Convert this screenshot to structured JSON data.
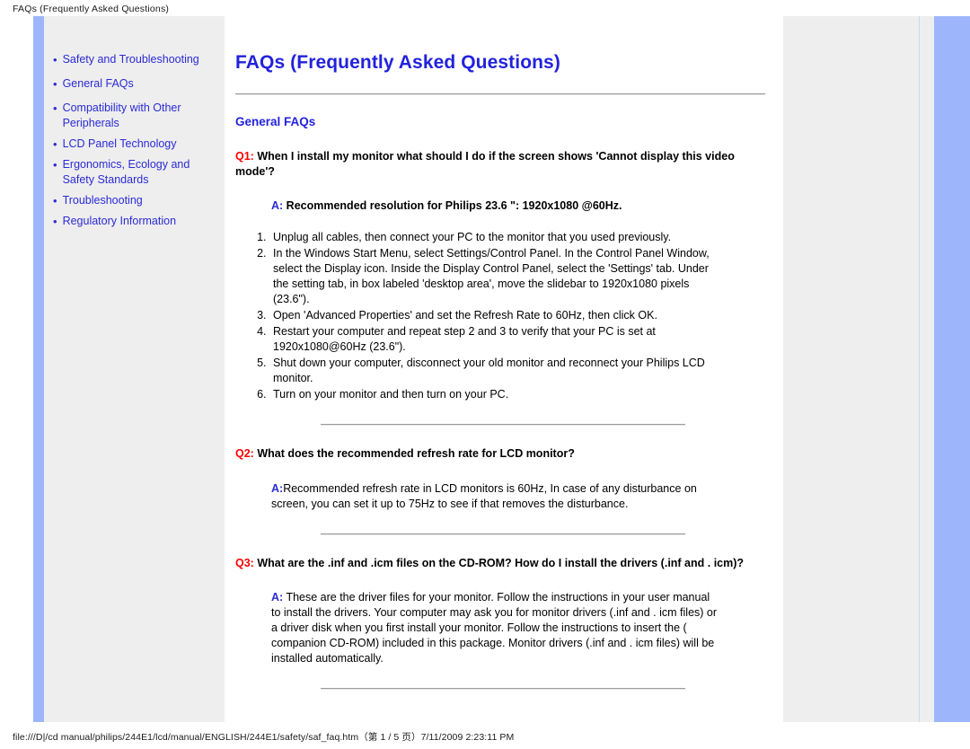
{
  "browser": {
    "header_title": "FAQs (Frequently Asked Questions)",
    "footer_path": "file:///D|/cd manual/philips/244E1/lcd/manual/ENGLISH/244E1/safety/saf_faq.htm（第 1 / 5 页）7/11/2009 2:23:11 PM"
  },
  "colors": {
    "link_blue": "#2b2bd6",
    "title_blue": "#2222dd",
    "question_red": "#ff0000",
    "accent_bar_blue": "#9db6fb",
    "panel_gray": "#eeeeee"
  },
  "sidebar": {
    "bullet": "•",
    "items": [
      {
        "label": "Safety and Troubleshooting"
      },
      {
        "label": "General FAQs"
      },
      {
        "label": "Compatibility with Other Peripherals"
      },
      {
        "label": "LCD Panel Technology"
      },
      {
        "label": "Ergonomics, Ecology and Safety Standards"
      },
      {
        "label": "Troubleshooting"
      },
      {
        "label": "Regulatory Information"
      }
    ]
  },
  "main": {
    "title": "FAQs (Frequently Asked Questions)",
    "section_title": "General FAQs",
    "faqs": [
      {
        "q_tag": "Q1:",
        "question": "When I install my monitor what should I do if the screen shows 'Cannot display this video mode'?",
        "a_tag": "A:",
        "answer": " Recommended resolution for Philips 23.6 \": 1920x1080 @60Hz.",
        "steps": [
          "Unplug all cables, then connect your PC to the monitor that you used previously.",
          "In the Windows Start Menu, select Settings/Control Panel. In the Control Panel Window, select the Display icon. Inside the Display Control Panel, select the 'Settings' tab. Under the setting tab, in box labeled 'desktop area', move the slidebar to 1920x1080 pixels (23.6\").",
          "Open 'Advanced Properties' and set the Refresh Rate to 60Hz, then click OK.",
          "Restart your computer and repeat step 2 and 3 to verify that your PC is set at 1920x1080@60Hz (23.6\").",
          "Shut down your computer, disconnect your old monitor and reconnect your Philips LCD monitor.",
          "Turn on your monitor and then turn on your PC."
        ]
      },
      {
        "q_tag": "Q2:",
        "question": "What does the recommended refresh rate for LCD monitor?",
        "a_tag": "A:",
        "answer": "Recommended refresh rate in LCD monitors is 60Hz, In case of any disturbance on screen, you can set it up to 75Hz to see if that removes the disturbance.",
        "steps": []
      },
      {
        "q_tag": "Q3:",
        "question": "What are the .inf and .icm files on the CD-ROM? How do I install the drivers (.inf and . icm)?",
        "a_tag": "A:",
        "answer": " These are the driver files for your monitor. Follow the instructions in your user manual to install the drivers. Your computer may ask you for monitor drivers (.inf and . icm files) or a driver disk when you first install your monitor. Follow the instructions to insert the ( companion CD-ROM) included in this package. Monitor drivers (.inf and . icm files) will be installed automatically.",
        "steps": []
      }
    ]
  }
}
